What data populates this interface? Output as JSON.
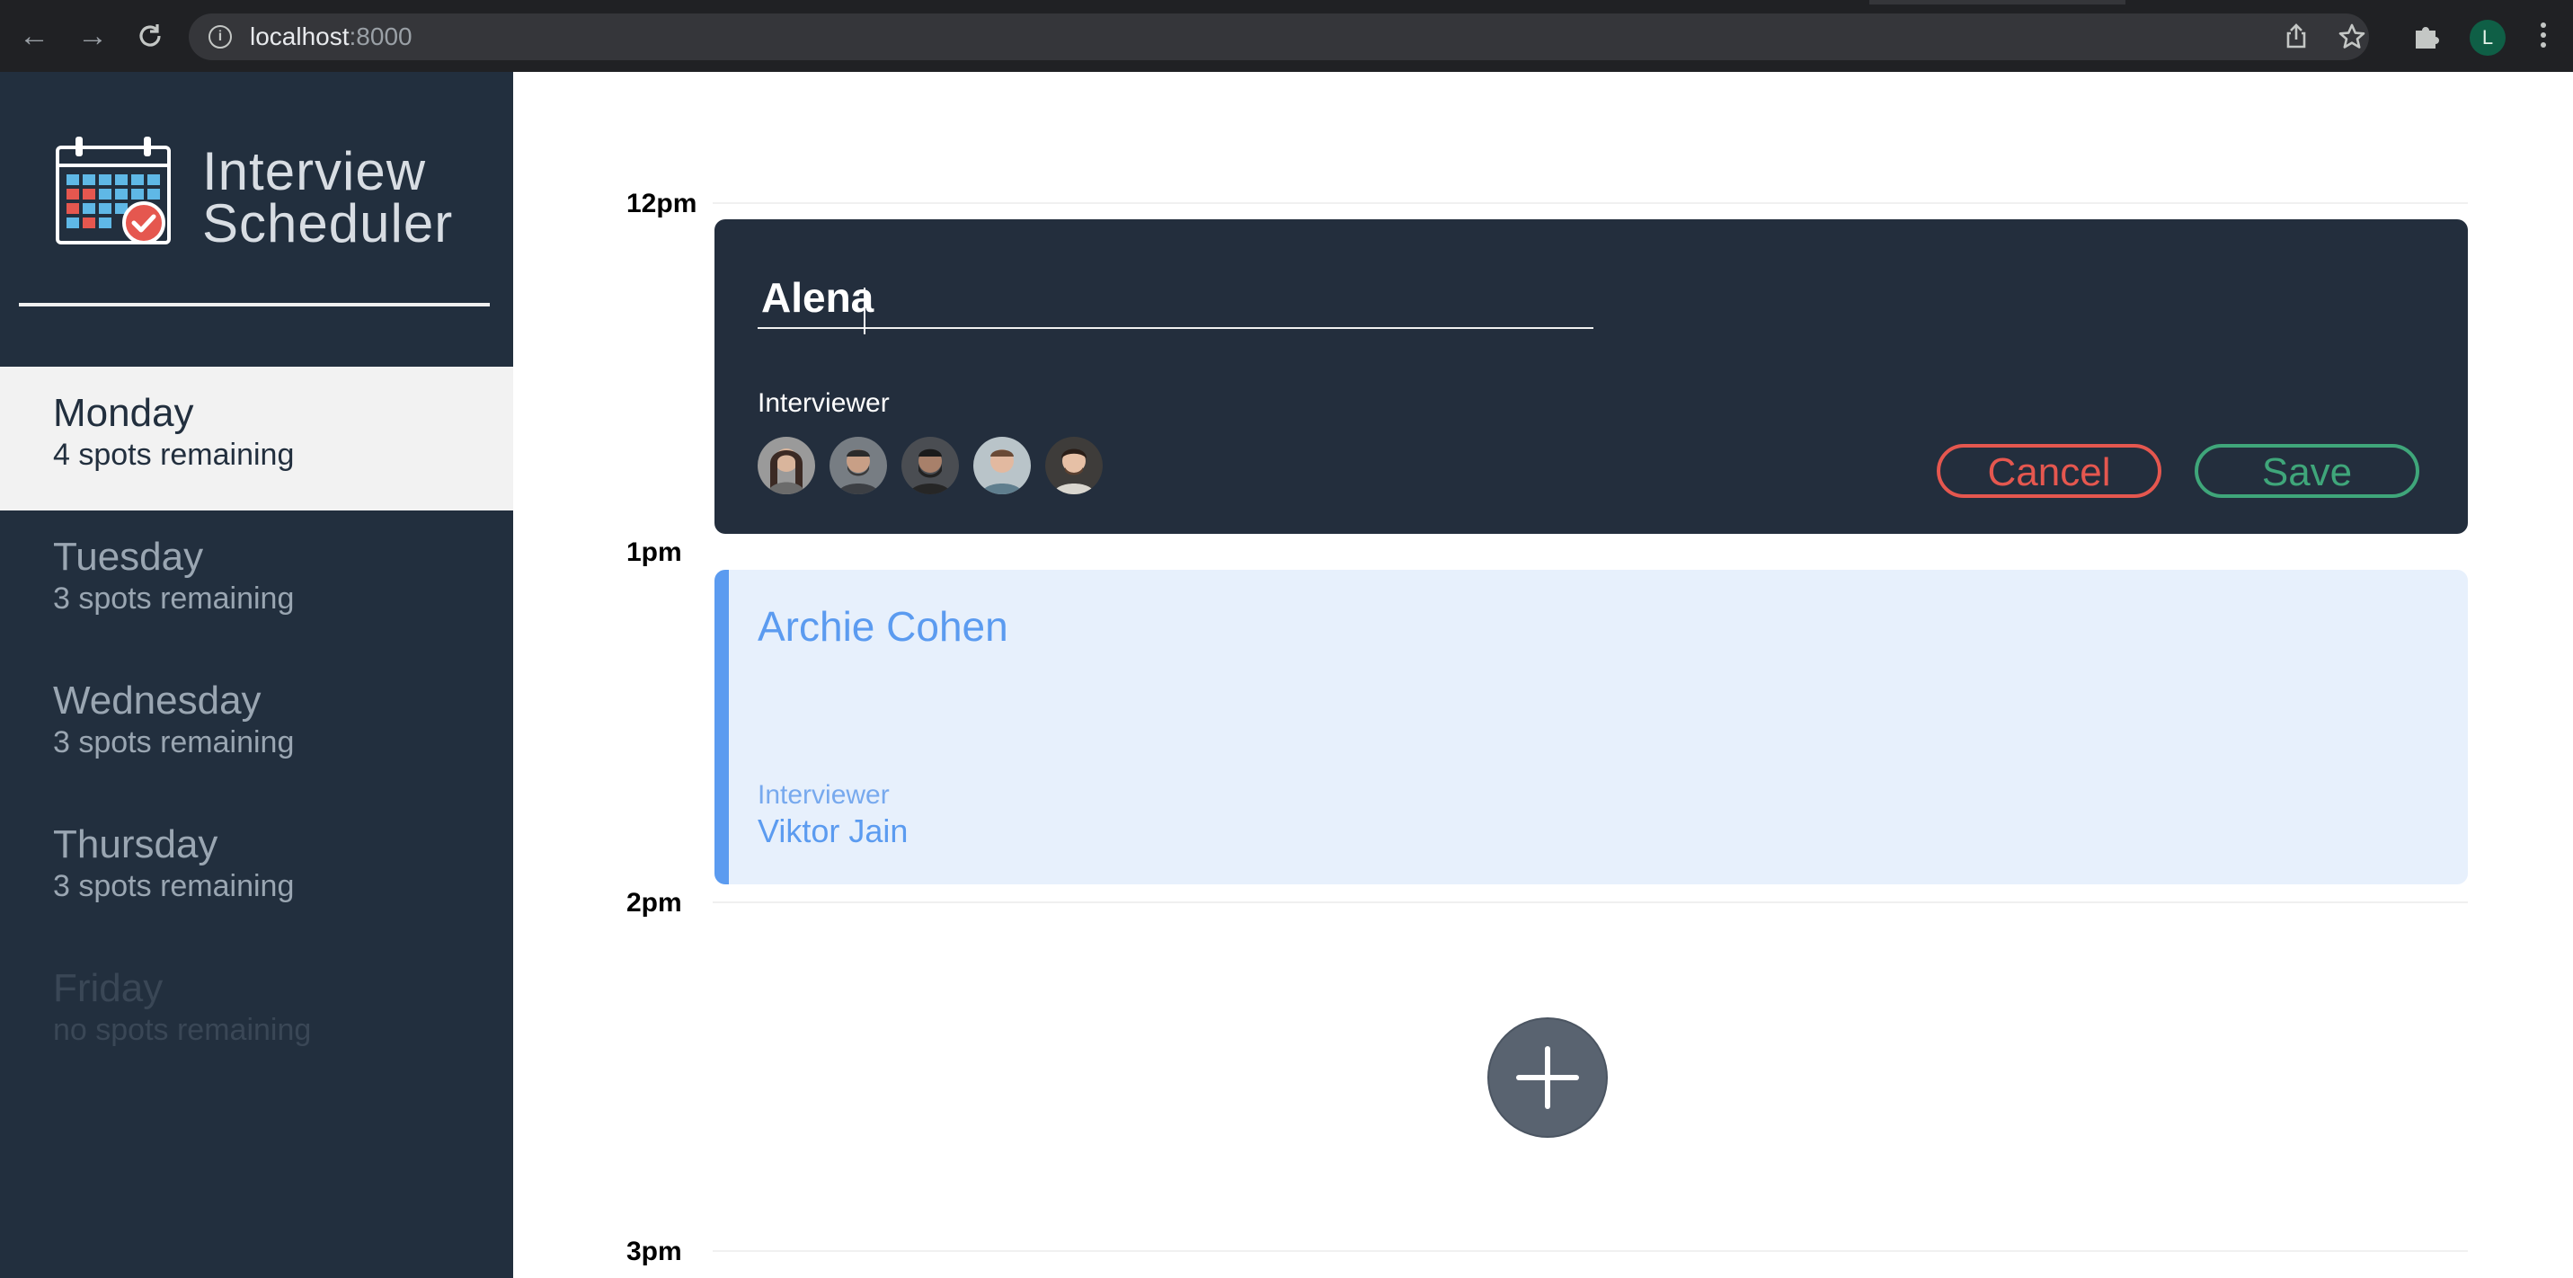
{
  "browser": {
    "url_host": "localhost",
    "url_port": ":8000",
    "profile_initial": "L"
  },
  "app": {
    "title_line1": "Interview",
    "title_line2": "Scheduler"
  },
  "days": [
    {
      "name": "Monday",
      "spots": "4 spots remaining",
      "state": "selected"
    },
    {
      "name": "Tuesday",
      "spots": "3 spots remaining",
      "state": "normal"
    },
    {
      "name": "Wednesday",
      "spots": "3 spots remaining",
      "state": "normal"
    },
    {
      "name": "Thursday",
      "spots": "3 spots remaining",
      "state": "normal"
    },
    {
      "name": "Friday",
      "spots": "no spots remaining",
      "state": "full"
    }
  ],
  "times": [
    "12pm",
    "1pm",
    "2pm",
    "3pm"
  ],
  "edit_form": {
    "student_name_value": "Alena",
    "interviewer_label": "Interviewer",
    "interviewer_count": 5,
    "cancel_label": "Cancel",
    "save_label": "Save"
  },
  "appointment": {
    "student": "Archie Cohen",
    "interviewer_label": "Interviewer",
    "interviewer_name": "Viktor Jain"
  },
  "colors": {
    "sidebar_bg": "#222f3e",
    "edit_card_bg": "#232e3d",
    "appointment_bg": "#e7f0fc",
    "accent_blue": "#5b9bf0",
    "cancel_red": "#e5574f",
    "save_green": "#3fa67a",
    "add_button": "#596370"
  }
}
